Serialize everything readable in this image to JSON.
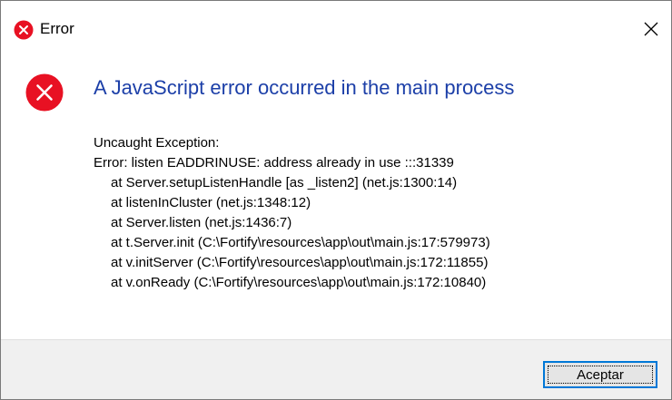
{
  "window": {
    "title": "Error",
    "close_glyph": "✕",
    "title_icon": "error-icon"
  },
  "dialog": {
    "icon": "error-icon",
    "heading": "A JavaScript error occurred in the main process",
    "message_lines": [
      "Uncaught Exception:",
      "Error: listen EADDRINUSE: address already in use :::31339",
      "at Server.setupListenHandle [as _listen2] (net.js:1300:14)",
      "at listenInCluster (net.js:1348:12)",
      "at Server.listen (net.js:1436:7)",
      "at t.Server.init (C:\\Fortify\\resources\\app\\out\\main.js:17:579973)",
      "at v.initServer (C:\\Fortify\\resources\\app\\out\\main.js:172:11855)",
      "at v.onReady (C:\\Fortify\\resources\\app\\out\\main.js:172:10840)"
    ]
  },
  "footer": {
    "accept_label": "Aceptar"
  },
  "colors": {
    "error_red": "#e81123",
    "heading_blue": "#1c3fa8",
    "button_focus_blue": "#0078d7",
    "footer_bg": "#f0f0f0"
  }
}
